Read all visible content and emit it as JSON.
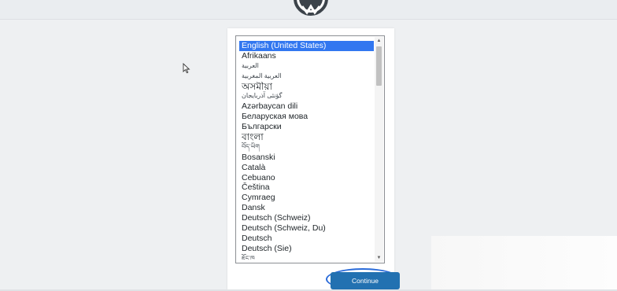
{
  "language_select": {
    "selected_index": 0,
    "options": [
      "English (United States)",
      "Afrikaans",
      "العربية",
      "العربية المغربية",
      "অসমীয়া",
      "گؤنئی آذربایجان",
      "Azərbaycan dili",
      "Беларуская мова",
      "Български",
      "বাংলা",
      "བོད་ཡིག",
      "Bosanski",
      "Català",
      "Cebuano",
      "Čeština",
      "Cymraeg",
      "Dansk",
      "Deutsch (Schweiz)",
      "Deutsch (Schweiz, Du)",
      "Deutsch",
      "Deutsch (Sie)",
      "ཇོང་ཁ"
    ]
  },
  "continue_button": {
    "label": "Continue"
  },
  "colors": {
    "accent": "#2271b1",
    "selection": "#3277f0",
    "annotation": "#2a6bd9",
    "background": "#eef0f2"
  },
  "icons": [
    "wordpress-logo-icon",
    "mouse-cursor-icon",
    "scroll-up-arrow-icon",
    "scroll-down-arrow-icon"
  ]
}
